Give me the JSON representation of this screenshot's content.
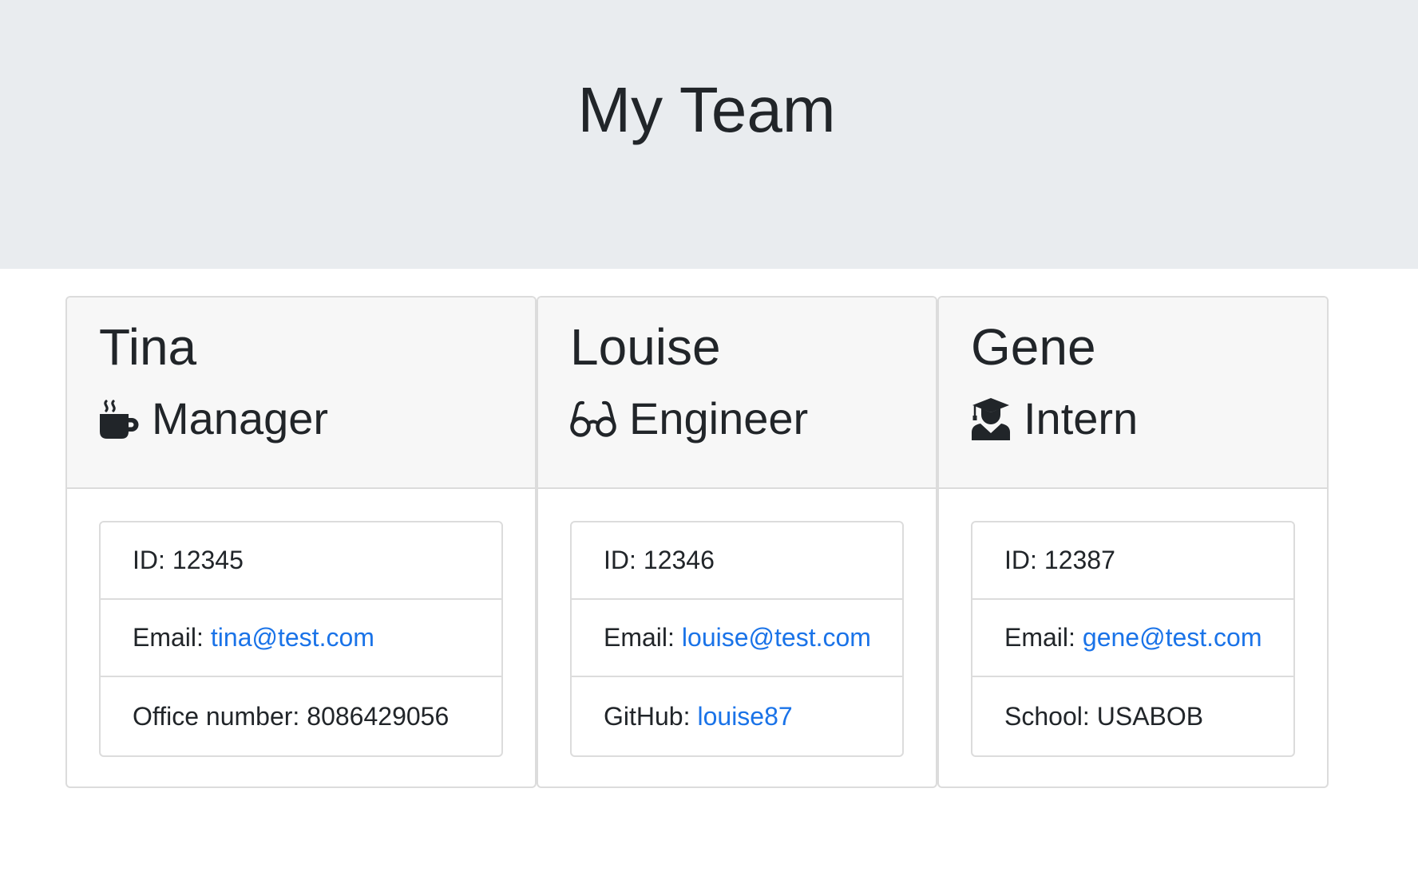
{
  "page": {
    "title": "My Team"
  },
  "colors": {
    "jumbotron_bg": "#e9ecef",
    "card_header_bg": "#f7f7f7",
    "link": "#1a73e8",
    "text": "#212529"
  },
  "team": [
    {
      "name": "Tina",
      "role": "Manager",
      "icon": "coffee-mug-icon",
      "id_label": "ID:",
      "id": "12345",
      "email_label": "Email:",
      "email": "tina@test.com",
      "extra_label": "Office number:",
      "extra": "8086429056"
    },
    {
      "name": "Louise",
      "role": "Engineer",
      "icon": "glasses-icon",
      "id_label": "ID:",
      "id": "12346",
      "email_label": "Email:",
      "email": "louise@test.com",
      "extra_label": "GitHub:",
      "extra": "louise87"
    },
    {
      "name": "Gene",
      "role": "Intern",
      "icon": "graduate-icon",
      "id_label": "ID:",
      "id": "12387",
      "email_label": "Email:",
      "email": "gene@test.com",
      "extra_label": "School:",
      "extra": "USABOB"
    }
  ]
}
